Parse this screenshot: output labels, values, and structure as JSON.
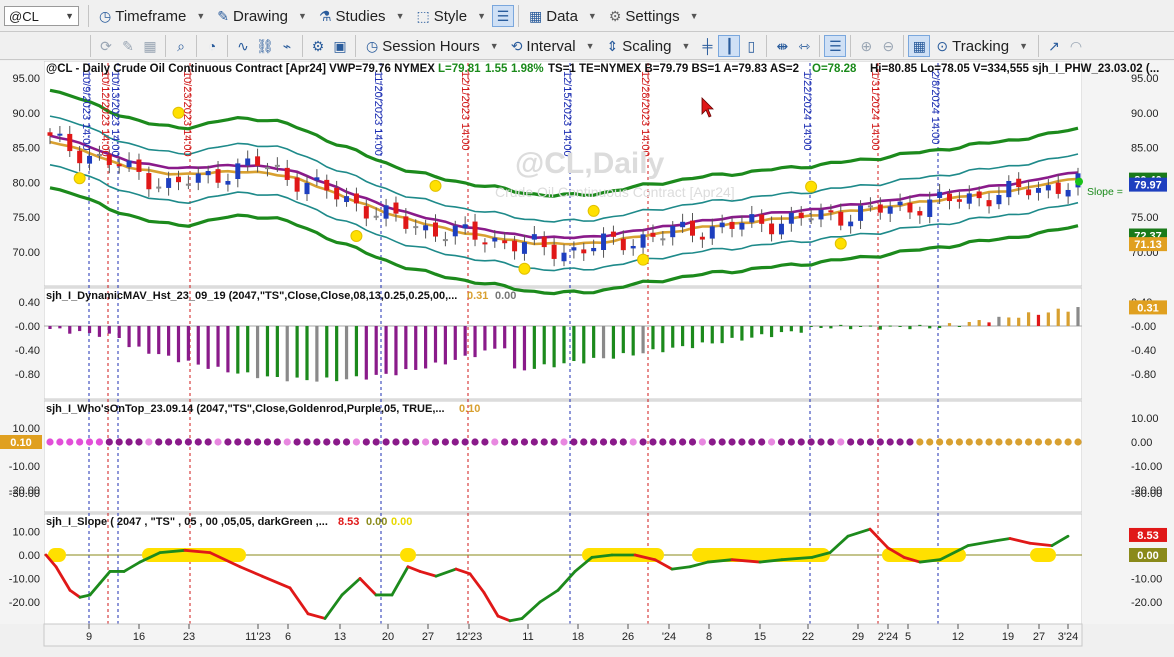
{
  "toolbar1": {
    "symbol": "@CL",
    "timeframe": "Timeframe",
    "drawing": "Drawing",
    "studies": "Studies",
    "style": "Style",
    "data": "Data",
    "settings": "Settings"
  },
  "toolbar2": {
    "session_hours": "Session Hours",
    "interval": "Interval",
    "scaling": "Scaling",
    "tracking": "Tracking"
  },
  "price_pane": {
    "header": "@CL - Daily  Crude Oil Continuous Contract [Apr24]  VWP=79.76  NYMEX",
    "last": "L=79.81",
    "chg": "1.55",
    "pct": "1.98%",
    "header2": "TS=1  TE=NYMEX  B=79.79  BS=1  A=79.83  AS=2",
    "open": "O=78.28",
    "hilo": "Hi=80.85  Lo=78.05  V=334,555  sjh_I_PHW_23.03.02 (...",
    "watermark": "@CL,Daily",
    "watermark_sub": "Crude Oil Continuous Contract [Apr24]",
    "slope_label": "Slope =",
    "y_ticks": [
      "95.00",
      "90.00",
      "85.00",
      "80.00",
      "75.00",
      "70.00"
    ],
    "right_ticks": [
      "95.00",
      "90.00",
      "85.00",
      "75.00",
      "70.00"
    ],
    "badges": [
      {
        "text": "80.40",
        "bg": "#1a7a1a"
      },
      {
        "text": "79.97",
        "bg": "#1e3fbf"
      },
      {
        "text": "72.37",
        "bg": "#1a7a1a"
      },
      {
        "text": "71.13",
        "bg": "#e0a020"
      }
    ],
    "vlines": [
      {
        "text": "10/9/2023 14:00",
        "color": "#1d2fb3"
      },
      {
        "text": "10/12/2023 14:00",
        "color": "#d01818"
      },
      {
        "text": "10/13/2023 14:00",
        "color": "#1d2fb3"
      },
      {
        "text": "10/23/2023 14:00",
        "color": "#d01818"
      },
      {
        "text": "11/20/2023 14:00",
        "color": "#1d2fb3"
      },
      {
        "text": "12/1/2023 14:00",
        "color": "#d01818"
      },
      {
        "text": "12/15/2023 14:00",
        "color": "#1d2fb3"
      },
      {
        "text": "12/28/2023 14:00",
        "color": "#d01818"
      },
      {
        "text": "1/22/2024 14:00",
        "color": "#1d2fb3"
      },
      {
        "text": "1/31/2024 14:00",
        "color": "#d01818"
      },
      {
        "text": "2/8/2024 14:00",
        "color": "#1d2fb3"
      }
    ]
  },
  "pane2": {
    "title": "sjh_I_DynamicMAV_Hst_23_09_19 (2047,\"TS\",Close,Close,08,13,0.25,0.25,00,...",
    "v1": "0.31",
    "v2": "0.00",
    "y_ticks": [
      "0.40",
      "-0.00",
      "-0.40",
      "-0.80"
    ],
    "right_ticks": [
      "0.40",
      "-0.00",
      "-0.40",
      "-0.80"
    ],
    "badge": "0.31"
  },
  "pane3": {
    "title": "sjh_I_Who'sOnTop_23.09.14 (2047,\"TS\",Close,Goldenrod,Purple,05,  TRUE,...",
    "v1": "0.10",
    "y_ticks": [
      "10.00",
      "-10.00",
      "-20.00",
      "-30.00"
    ],
    "right_ticks": [
      "10.00",
      "0.00",
      "-10.00",
      "-20.00",
      "-30.00"
    ],
    "left_badge": "0.10"
  },
  "pane4": {
    "title": "sjh_I_Slope ( 2047 , \"TS\" , 05 , 00 ,05,05, darkGreen ,...",
    "v1": "8.53",
    "v2": "0.00",
    "v3": "0.00",
    "y_ticks": [
      "10.00",
      "0.00",
      "-10.00",
      "-20.00"
    ],
    "right_ticks": [
      "-10.00",
      "-20.00"
    ],
    "badge1": "8.53",
    "badge2": "0.00"
  },
  "x_axis": [
    "9",
    "16",
    "23",
    "11'23",
    "6",
    "13",
    "20",
    "27",
    "12'23",
    "11",
    "18",
    "26",
    "'24",
    "8",
    "15",
    "22",
    "29",
    "2'24",
    "5",
    "12",
    "19",
    "27",
    "3'24"
  ],
  "colors": {
    "up_bar": "#1e3fbf",
    "down_bar": "#e01818",
    "neutral_bar": "#8a8a8a",
    "band_green": "#1c8a1c",
    "band_teal": "#1e8a8a",
    "ma_purple": "#8a1a8a",
    "ma_gold": "#d8a030",
    "slope_up": "#1c8a1c",
    "slope_down": "#e01818",
    "marker_yellow": "#ffe000"
  }
}
